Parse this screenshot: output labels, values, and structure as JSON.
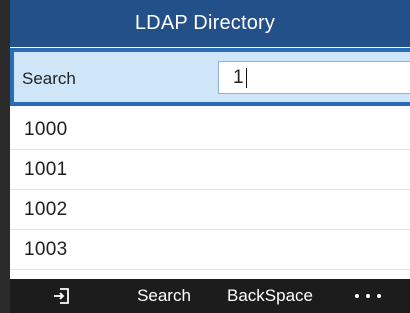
{
  "title": "LDAP Directory",
  "search": {
    "label": "Search",
    "value": "1"
  },
  "results": [
    "1000",
    "1001",
    "1002",
    "1003"
  ],
  "softkeys": {
    "exit_icon": "exit-icon",
    "search": "Search",
    "backspace": "BackSpace",
    "more_icon": "more-icon"
  },
  "colors": {
    "title_bar": "#235088",
    "search_row_bg": "#cfe6f9",
    "search_row_border": "#2a6db4",
    "softkey_bar": "#1c1c1c"
  }
}
